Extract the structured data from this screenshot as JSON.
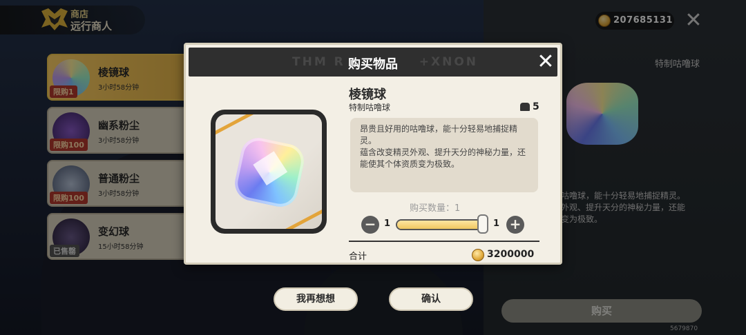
{
  "header": {
    "shop_small": "商店",
    "shop_big": "远行商人",
    "currency_value": "207685131",
    "close_icon": "close-icon"
  },
  "shop_list": [
    {
      "name": "棱镜球",
      "time": "3小时58分钟",
      "limit": "限购1",
      "selected": true
    },
    {
      "name": "幽系粉尘",
      "time": "3小时58分钟",
      "limit": "限购100",
      "selected": false
    },
    {
      "name": "普通粉尘",
      "time": "3小时58分钟",
      "limit": "限购100",
      "selected": false
    },
    {
      "name": "变幻球",
      "time": "15小时58分钟",
      "limit": "已售罄",
      "selected": false
    }
  ],
  "right_panel": {
    "subtitle": "特制咕噜球",
    "desc_lines": [
      "咕噜球，能十分轻易地捕捉精灵。",
      "外观、提升天分的神秘力量，还能",
      "变为极致。"
    ],
    "buy_label": "购买"
  },
  "uid": "5679870",
  "modal": {
    "deco_text": "THM R",
    "deco_text_right": "+XNON",
    "title": "购买物品",
    "item_name": "棱镜球",
    "item_sub": "特制咕噜球",
    "owned_count": "5",
    "desc_p1": "昂贵且好用的咕噜球，能十分轻易地捕捉精灵。",
    "desc_p2": "蕴含改变精灵外观、提升天分的神秘力量，还能使其个体资质变为极致。",
    "qty_label": "购买数量：1",
    "qty_min": "1",
    "qty_max": "1",
    "qty_fraction": 1.0,
    "total_label": "合计",
    "total_value": "3200000"
  },
  "actions": {
    "cancel_label": "我再想想",
    "confirm_label": "确认"
  },
  "colors": {
    "accent_gold": "#f0c64f",
    "limit_red": "#b43a2f",
    "modal_bg": "#f3efe5",
    "header_dark": "#2f2f2f"
  }
}
